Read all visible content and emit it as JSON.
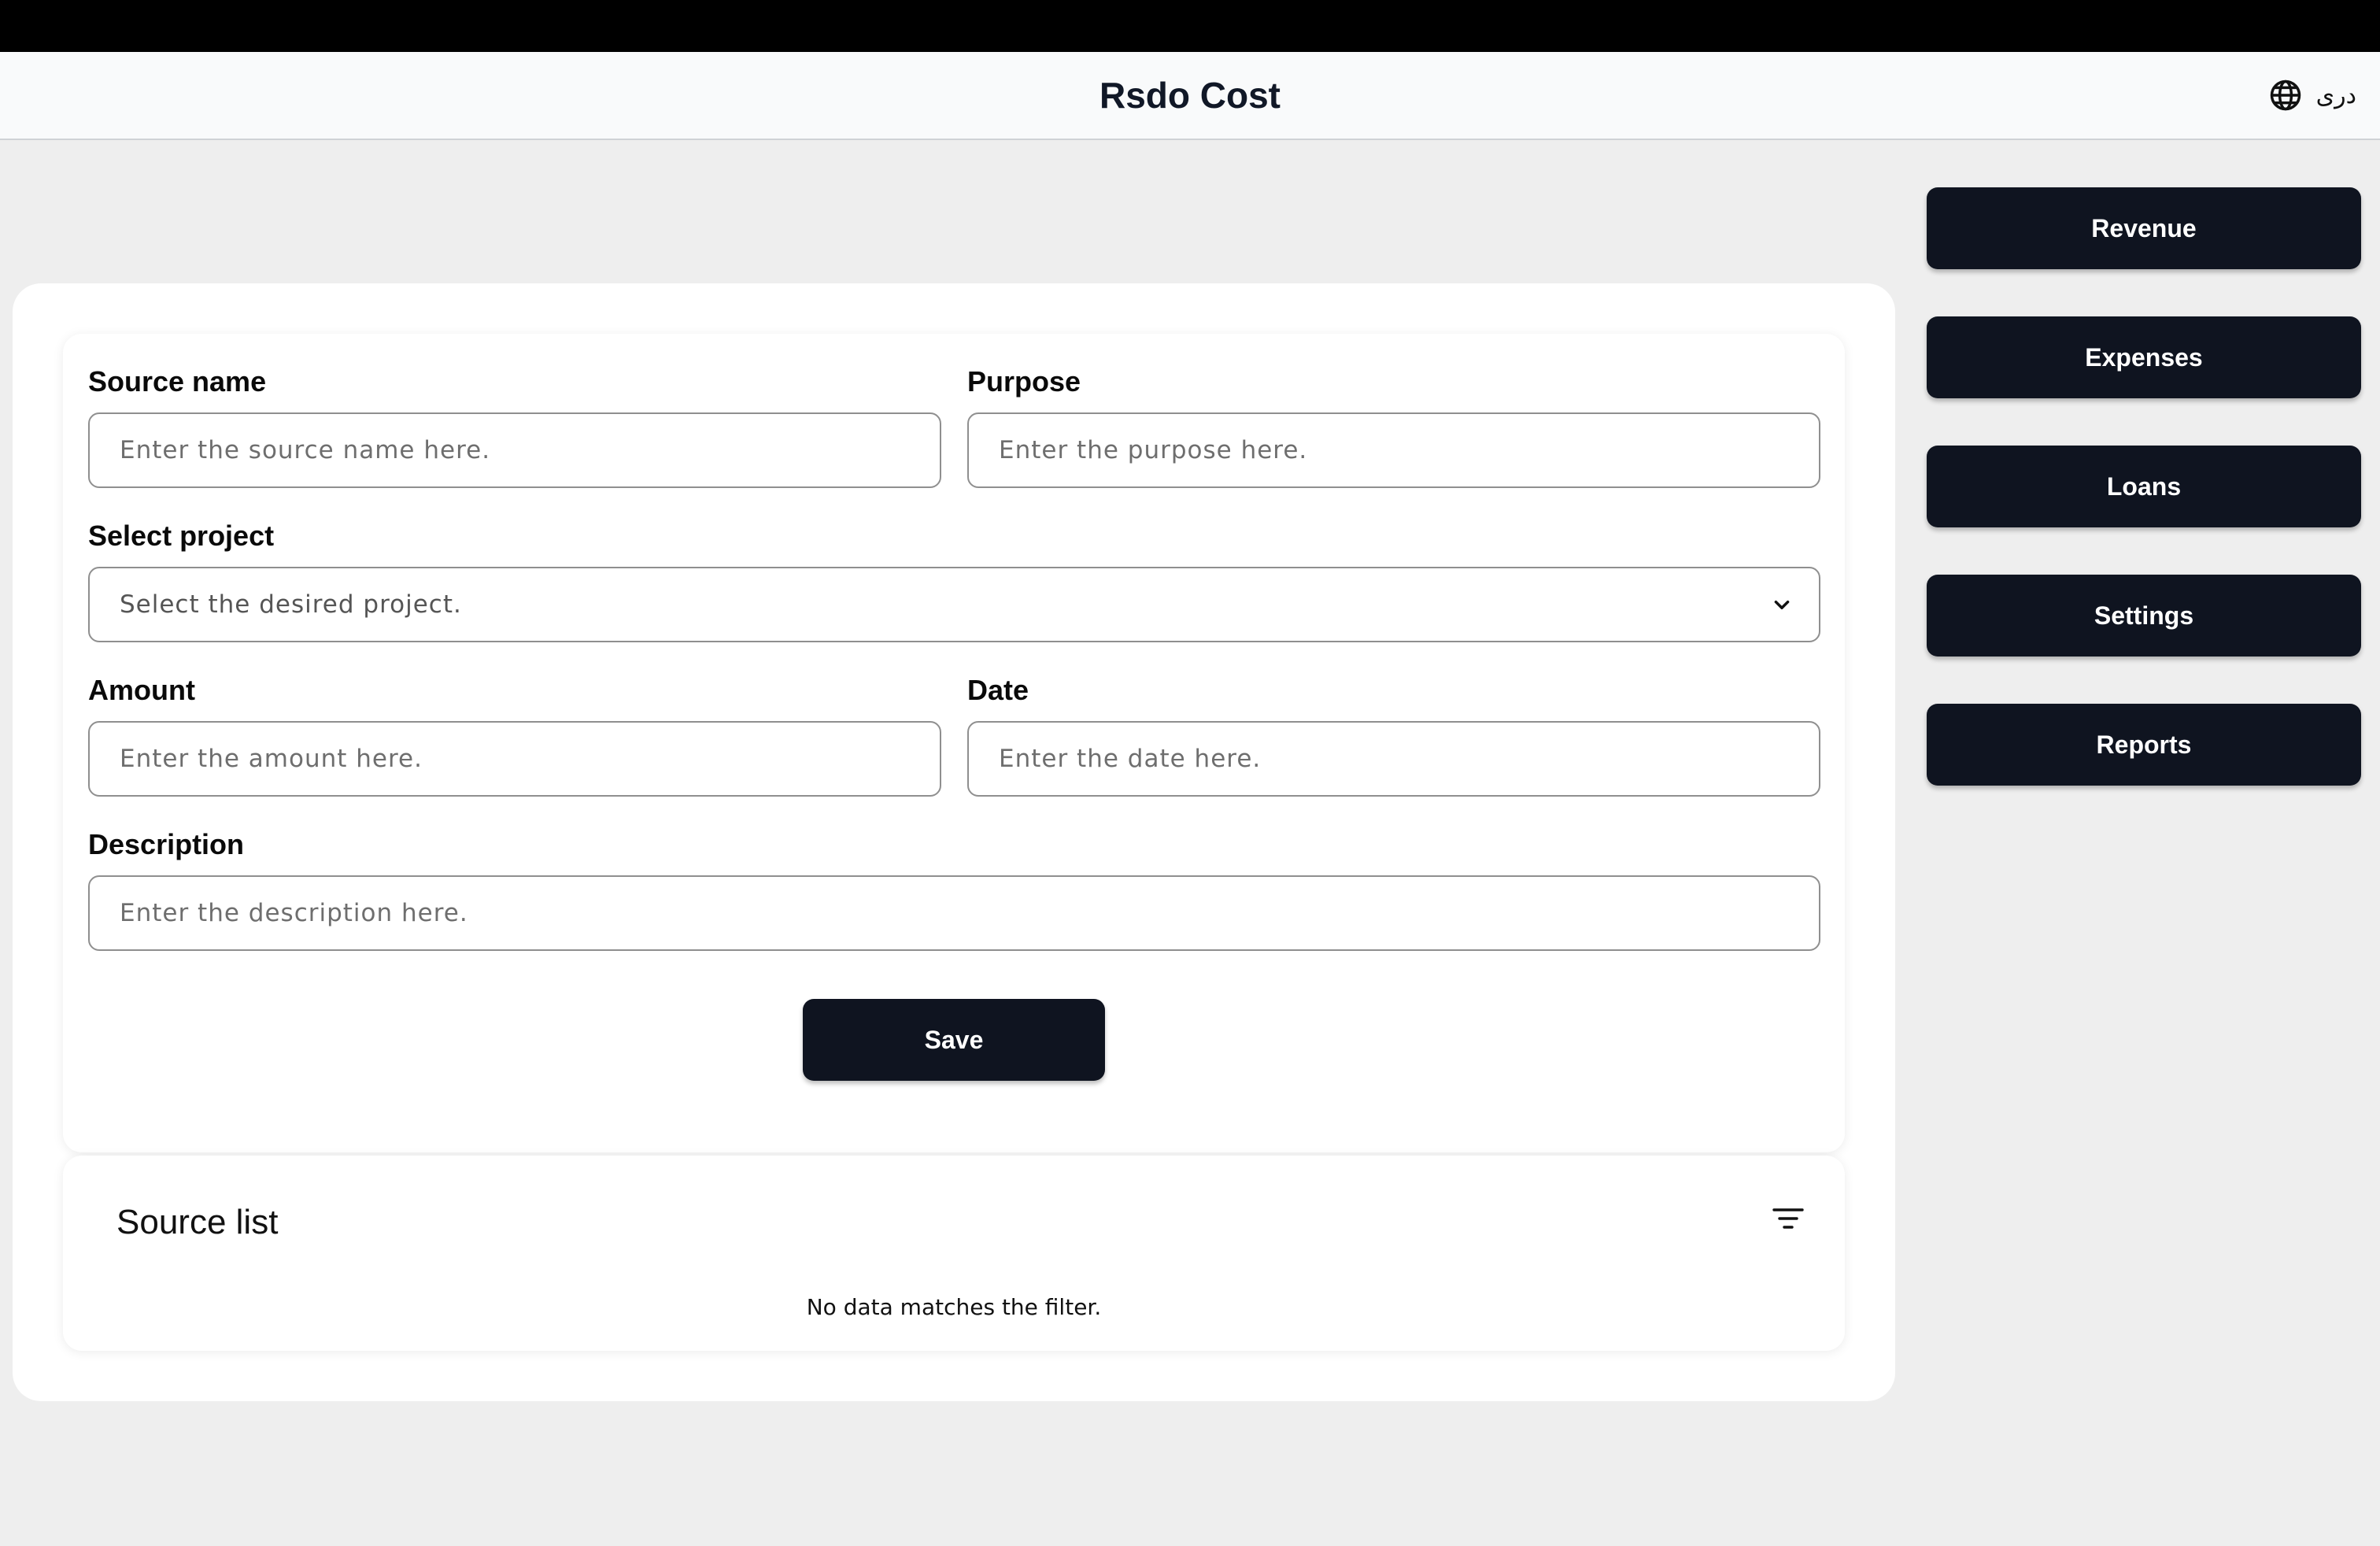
{
  "header": {
    "title": "Rsdo Cost",
    "language_label": "دری",
    "language_icon": "globe-icon"
  },
  "nav": {
    "items": [
      {
        "label": "Revenue"
      },
      {
        "label": "Expenses"
      },
      {
        "label": "Loans"
      },
      {
        "label": "Settings"
      },
      {
        "label": "Reports"
      }
    ]
  },
  "form": {
    "source_name": {
      "label": "Source name",
      "placeholder": "Enter the source name here.",
      "value": ""
    },
    "purpose": {
      "label": "Purpose",
      "placeholder": "Enter the purpose here.",
      "value": ""
    },
    "project": {
      "label": "Select project",
      "selected": "Select the desired project.",
      "icon": "chevron-down-icon"
    },
    "amount": {
      "label": "Amount",
      "placeholder": "Enter the amount here.",
      "value": ""
    },
    "date": {
      "label": "Date",
      "placeholder": "Enter the date here.",
      "value": ""
    },
    "description": {
      "label": "Description",
      "placeholder": "Enter the description here.",
      "value": ""
    },
    "save_label": "Save"
  },
  "source_list": {
    "title": "Source list",
    "filter_icon": "filter-icon",
    "empty_message": "No data matches the filter."
  },
  "colors": {
    "button_bg": "#0f1420",
    "page_bg": "#eeeeee",
    "header_bg": "#f9fafb",
    "card_bg": "#ffffff"
  }
}
